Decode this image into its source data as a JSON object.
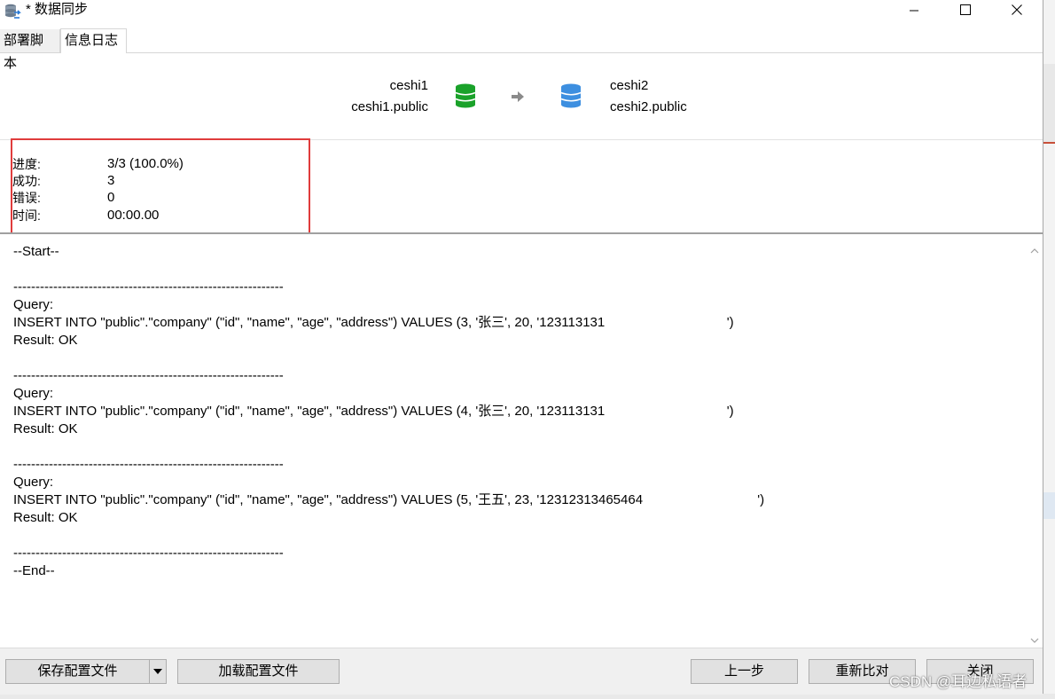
{
  "window": {
    "title": "* 数据同步"
  },
  "tabs": [
    {
      "label": "部署脚本"
    },
    {
      "label": "信息日志"
    }
  ],
  "connection": {
    "source_name": "ceshi1",
    "source_schema": "ceshi1.public",
    "target_name": "ceshi2",
    "target_schema": "ceshi2.public",
    "source_icon": "database-green-icon",
    "target_icon": "database-blue-icon",
    "arrow_icon": "arrow-right-icon"
  },
  "stats": {
    "progress_label": "进度:",
    "progress_value": "3/3 (100.0%)",
    "success_label": "成功:",
    "success_value": "3",
    "error_label": "错误:",
    "error_value": "0",
    "time_label": "时间:",
    "time_value": "00:00.00"
  },
  "log": {
    "lines": [
      "--Start--",
      "",
      "-------------------------------------------------------------",
      "Query:",
      "INSERT INTO \"public\".\"company\" (\"id\", \"name\", \"age\", \"address\") VALUES (3, '张三', 20, '123113131                                 ')",
      "Result: OK",
      "",
      "-------------------------------------------------------------",
      "Query:",
      "INSERT INTO \"public\".\"company\" (\"id\", \"name\", \"age\", \"address\") VALUES (4, '张三', 20, '123113131                                 ')",
      "Result: OK",
      "",
      "-------------------------------------------------------------",
      "Query:",
      "INSERT INTO \"public\".\"company\" (\"id\", \"name\", \"age\", \"address\") VALUES (5, '王五', 23, '12312313465464                               ')",
      "Result: OK",
      "",
      "-------------------------------------------------------------",
      "--End--"
    ]
  },
  "buttons": {
    "save_config": "保存配置文件",
    "load_config": "加载配置文件",
    "prev_step": "上一步",
    "recompare": "重新比对",
    "close": "关闭"
  },
  "watermark": "CSDN @耳边私语者",
  "colors": {
    "highlight_box": "#e03c3c",
    "db_source": "#1aa22a",
    "db_target": "#3d8fe0"
  }
}
